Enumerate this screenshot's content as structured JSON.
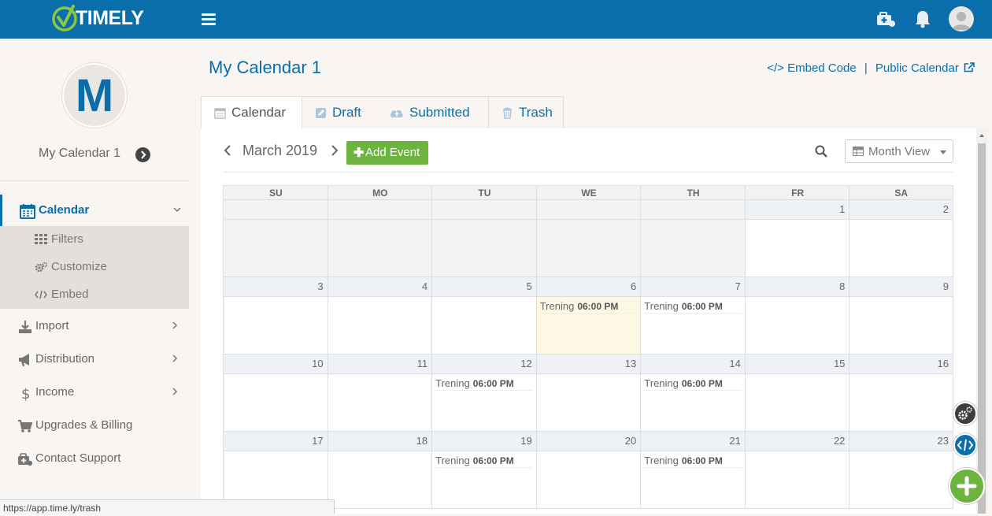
{
  "brand": {
    "logo_text": "TIMELY"
  },
  "sidebar": {
    "calendar_name": "My Calendar 1",
    "avatar_letter": "M",
    "nav": [
      {
        "label": "Calendar",
        "icon": "calendar-icon"
      },
      {
        "label": "Import",
        "icon": "import-icon"
      },
      {
        "label": "Distribution",
        "icon": "megaphone-icon"
      },
      {
        "label": "Income",
        "icon": "dollar-icon"
      },
      {
        "label": "Upgrades & Billing",
        "icon": "cart-icon"
      },
      {
        "label": "Contact Support",
        "icon": "support-icon"
      }
    ],
    "subnav": [
      {
        "label": "Filters",
        "icon": "grid-icon"
      },
      {
        "label": "Customize",
        "icon": "gears-icon"
      },
      {
        "label": "Embed",
        "icon": "code-icon"
      }
    ]
  },
  "header": {
    "page_title": "My Calendar 1",
    "embed_code": "</> Embed Code",
    "separator": "|",
    "public_calendar": "Public Calendar"
  },
  "tabs": [
    {
      "label": "Calendar",
      "icon": "calendar-icon",
      "active": true
    },
    {
      "label": "Draft",
      "icon": "edit-icon",
      "active": false
    },
    {
      "label": "Submitted",
      "icon": "cloud-upload-icon",
      "active": false
    },
    {
      "label": "Trash",
      "icon": "trash-icon",
      "active": false
    }
  ],
  "toolbar": {
    "month_label": "March 2019",
    "add_event": "Add Event",
    "view_select": "Month View"
  },
  "calendar": {
    "weekdays": [
      "SU",
      "MO",
      "TU",
      "WE",
      "TH",
      "FR",
      "SA"
    ],
    "weeks": [
      [
        null,
        null,
        null,
        null,
        null,
        "1",
        "2"
      ],
      [
        "3",
        "4",
        "5",
        "6",
        "7",
        "8",
        "9"
      ],
      [
        "10",
        "11",
        "12",
        "13",
        "14",
        "15",
        "16"
      ],
      [
        "17",
        "18",
        "19",
        "20",
        "21",
        "22",
        "23"
      ]
    ],
    "today": "6",
    "event_title": "Trening",
    "event_time": "06:00 PM",
    "event_days": [
      "6",
      "7",
      "12",
      "14",
      "19",
      "21"
    ]
  },
  "status_bar": {
    "url": "https://app.time.ly/trash"
  },
  "colors": {
    "primary": "#0a6eab",
    "accent_green": "#6db33f",
    "today_bg": "#fcf8e3"
  }
}
